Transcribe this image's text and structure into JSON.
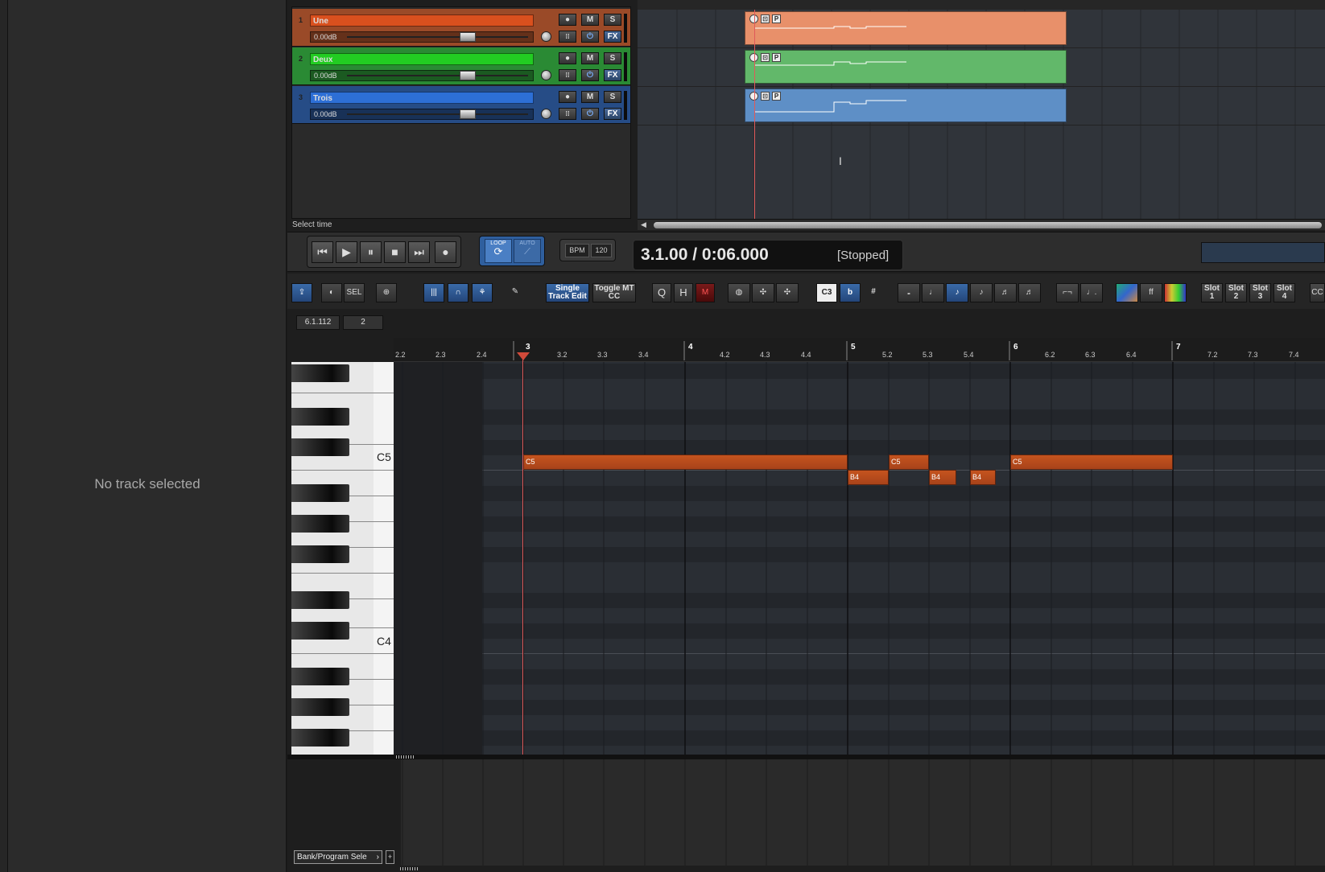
{
  "inspector": {
    "empty_text": "No track selected"
  },
  "tracks": [
    {
      "number": "1",
      "name": "Une",
      "volume": "0.00dB",
      "color": "#d9501e",
      "panel_color": "#9a4a28",
      "item_color": "#e8906a"
    },
    {
      "number": "2",
      "name": "Deux",
      "volume": "0.00dB",
      "color": "#22cc22",
      "panel_color": "#2a8a34",
      "item_color": "#62b86a"
    },
    {
      "number": "3",
      "name": "Trois",
      "volume": "0.00dB",
      "color": "#2d6fd6",
      "panel_color": "#264c86",
      "item_color": "#5e8fc6"
    }
  ],
  "track_buttons": {
    "record": "●",
    "mute": "M",
    "solo": "S",
    "fx": "FX",
    "env": "⁞⁞",
    "phase": "⏻"
  },
  "item_icons": {
    "lock": "⊡",
    "pool": "P"
  },
  "status": {
    "hint": "Select time"
  },
  "transport": {
    "loop_label": "LOOP",
    "auto_label": "AUTO",
    "bpm_label": "BPM",
    "bpm_value": "120",
    "time": "3.1.00 / 0:06.000",
    "state": "[Stopped]",
    "icons": [
      "skip-back-icon",
      "play-icon",
      "pause-icon",
      "stop-icon",
      "skip-forward-icon",
      "record-icon"
    ]
  },
  "midi_toolbar": {
    "sel": "SEL",
    "single_track_edit": "Single Track Edit",
    "single_track_edit_l1": "Single",
    "single_track_edit_l2": "Track Edit",
    "toggle_mt_cc_l1": "Toggle MT",
    "toggle_mt_cc_l2": "CC",
    "quantize": "Q",
    "humanize": "H",
    "mute": "M",
    "key_c3": "C3",
    "flat": "b",
    "sharp": "#",
    "slots": [
      "Slot 1",
      "Slot 2",
      "Slot 3",
      "Slot 4"
    ],
    "slot_l1": "Slot",
    "slot_nums": [
      "1",
      "2",
      "3",
      "4"
    ],
    "cc_clip": "CC"
  },
  "position_fields": {
    "position": "6.1.112",
    "length": "2"
  },
  "ruler": {
    "ticks": [
      "2.2",
      "2.3",
      "2.4",
      "3.2",
      "3.3",
      "3.4",
      "4.2",
      "4.3",
      "4.4",
      "5.2",
      "5.3",
      "5.4",
      "6.2",
      "6.3",
      "6.4",
      "7.2",
      "7.3",
      "7.4"
    ],
    "bars": [
      "3",
      "4",
      "5",
      "6",
      "7"
    ]
  },
  "keyboard": {
    "labels": [
      "C5",
      "C4"
    ]
  },
  "notes": [
    {
      "pitch": "C5",
      "start": "3.1",
      "end": "5.1"
    },
    {
      "pitch": "B4",
      "start": "5.1",
      "end": "5.2"
    },
    {
      "pitch": "C5",
      "start": "5.2",
      "end": "5.3"
    },
    {
      "pitch": "B4",
      "start": "5.3",
      "end": "5.4"
    },
    {
      "pitch": "B4",
      "start": "5.4",
      "end": "6.1"
    },
    {
      "pitch": "C5",
      "start": "6.1",
      "end": "7.1"
    }
  ],
  "cc_lane": {
    "selector": "Bank/Program Sele"
  },
  "colors": {
    "cursor": "#e05a5a",
    "note": "#c5541e",
    "accent_blue": "#3a6aa8"
  }
}
